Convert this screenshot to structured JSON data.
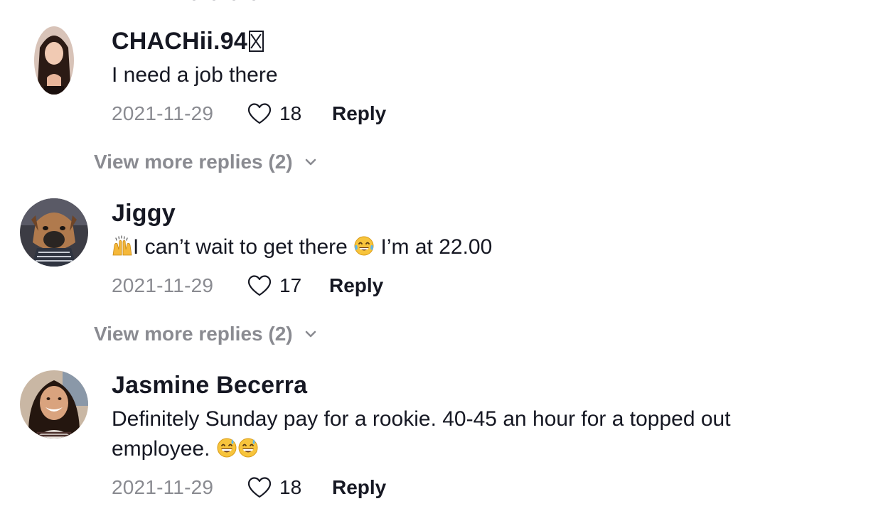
{
  "comments": [
    {
      "username": "CHACHii.94",
      "text": "I need a job there",
      "date": "2021-11-29",
      "likes": "18",
      "reply_label": "Reply",
      "more_replies_label": "View more replies (2)"
    },
    {
      "username": "Jiggy",
      "text_before": "I can’t wait to get there",
      "text_after": " I’m at 22.00",
      "emoji_1": "raising-hands-icon",
      "emoji_2": "tears-of-joy-icon",
      "date": "2021-11-29",
      "likes": "17",
      "reply_label": "Reply",
      "more_replies_label": "View more replies (2)"
    },
    {
      "username": "Jasmine Becerra",
      "text_line1": "Definitely Sunday pay for a rookie. 40-45 an hour for a topped out",
      "text_line2": "employee.",
      "emoji_1": "grinning-sweat-icon",
      "emoji_2": "grinning-sweat-icon",
      "date": "2021-11-29",
      "likes": "18",
      "reply_label": "Reply"
    }
  ],
  "colors": {
    "primary_text": "#161823",
    "secondary_text": "#8a8b91",
    "background": "#ffffff"
  }
}
